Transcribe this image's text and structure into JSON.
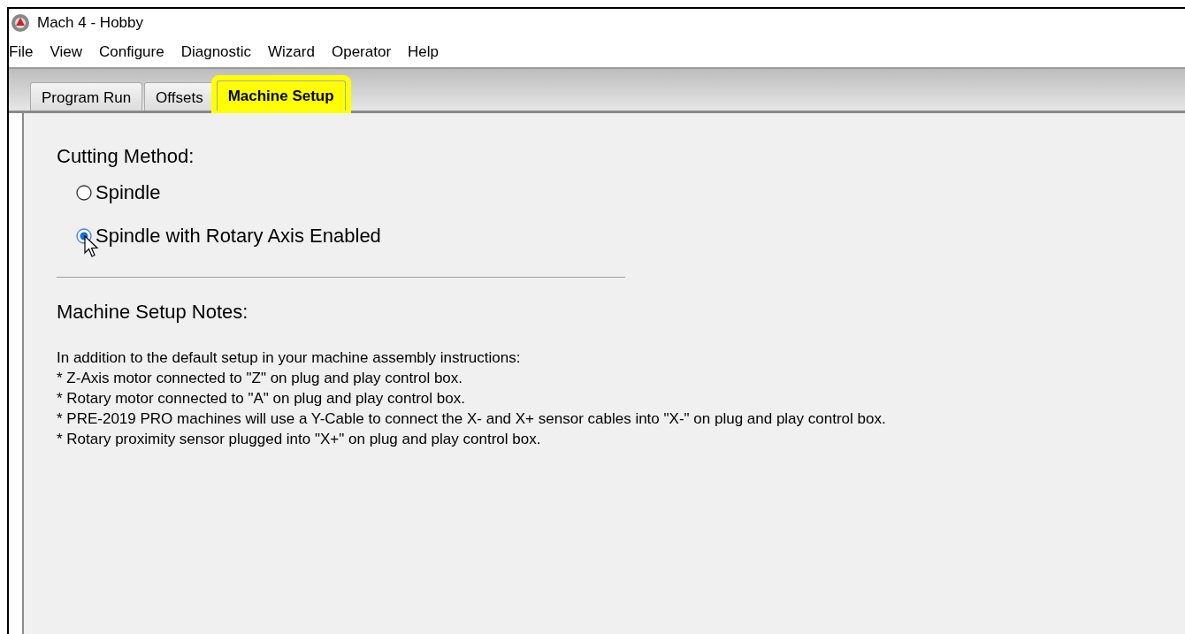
{
  "window": {
    "title": "Mach 4 - Hobby"
  },
  "menu": [
    "File",
    "View",
    "Configure",
    "Diagnostic",
    "Wizard",
    "Operator",
    "Help"
  ],
  "tabs": [
    {
      "label": "Program Run",
      "selected": false,
      "highlighted": false
    },
    {
      "label": "Offsets",
      "selected": false,
      "highlighted": false
    },
    {
      "label": "Machine Setup",
      "selected": true,
      "highlighted": true
    }
  ],
  "cutting_method": {
    "heading": "Cutting Method:",
    "options": [
      {
        "label": "Spindle",
        "selected": false
      },
      {
        "label": "Spindle with Rotary Axis Enabled",
        "selected": true
      }
    ]
  },
  "notes": {
    "heading": "Machine Setup Notes:",
    "lines": [
      "In addition to the default setup in your machine assembly instructions:",
      "* Z-Axis motor connected to \"Z\" on plug and play control box.",
      "* Rotary motor connected to \"A\" on plug and play control box.",
      "* PRE-2019 PRO machines will use a Y-Cable to connect the X- and X+ sensor cables into \"X-\" on plug and play control box.",
      "* Rotary proximity sensor plugged into \"X+\" on plug and play control box."
    ]
  }
}
